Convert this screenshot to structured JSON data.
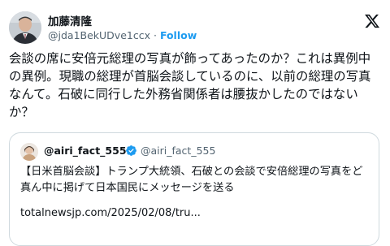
{
  "author": {
    "display_name": "加藤清隆",
    "handle": "@jda1BekUDve1ccx",
    "separator": "·",
    "follow_label": "Follow"
  },
  "brand_icon": "x-logo-icon",
  "tweet": {
    "text": "会談の席に安倍元総理の写真が飾ってあったのか？これは異例中の異例。現職の総理が首脳会談しているのに、以前の総理の写真なんて。石破に同行した外務省関係者は腰抜かしたのではないか？"
  },
  "quoted": {
    "display_name": "@airi_fact_555",
    "handle": "@airi_fact_555",
    "verified_icon": "verified-badge-icon",
    "text": "【日米首脳会談】トランプ大統領、石破との会談で安倍総理の写真をど真ん中に掲げて日本国民にメッセージを送る",
    "link": "totalnewsjp.com/2025/02/08/tru..."
  },
  "colors": {
    "accent": "#1d9bf0",
    "secondary_text": "#536471",
    "border": "#cfd9de"
  }
}
